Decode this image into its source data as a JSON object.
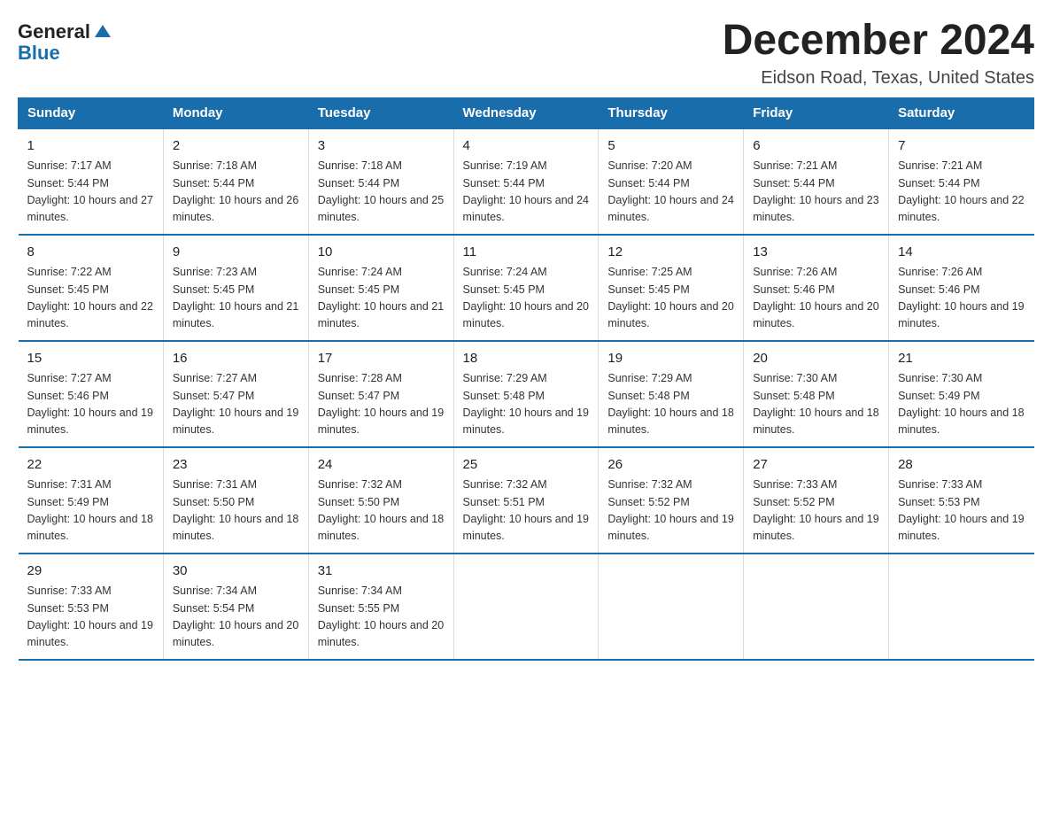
{
  "logo": {
    "text_general": "General",
    "text_blue": "Blue"
  },
  "title": "December 2024",
  "subtitle": "Eidson Road, Texas, United States",
  "headers": [
    "Sunday",
    "Monday",
    "Tuesday",
    "Wednesday",
    "Thursday",
    "Friday",
    "Saturday"
  ],
  "weeks": [
    [
      {
        "day": "1",
        "sunrise": "7:17 AM",
        "sunset": "5:44 PM",
        "daylight": "10 hours and 27 minutes."
      },
      {
        "day": "2",
        "sunrise": "7:18 AM",
        "sunset": "5:44 PM",
        "daylight": "10 hours and 26 minutes."
      },
      {
        "day": "3",
        "sunrise": "7:18 AM",
        "sunset": "5:44 PM",
        "daylight": "10 hours and 25 minutes."
      },
      {
        "day": "4",
        "sunrise": "7:19 AM",
        "sunset": "5:44 PM",
        "daylight": "10 hours and 24 minutes."
      },
      {
        "day": "5",
        "sunrise": "7:20 AM",
        "sunset": "5:44 PM",
        "daylight": "10 hours and 24 minutes."
      },
      {
        "day": "6",
        "sunrise": "7:21 AM",
        "sunset": "5:44 PM",
        "daylight": "10 hours and 23 minutes."
      },
      {
        "day": "7",
        "sunrise": "7:21 AM",
        "sunset": "5:44 PM",
        "daylight": "10 hours and 22 minutes."
      }
    ],
    [
      {
        "day": "8",
        "sunrise": "7:22 AM",
        "sunset": "5:45 PM",
        "daylight": "10 hours and 22 minutes."
      },
      {
        "day": "9",
        "sunrise": "7:23 AM",
        "sunset": "5:45 PM",
        "daylight": "10 hours and 21 minutes."
      },
      {
        "day": "10",
        "sunrise": "7:24 AM",
        "sunset": "5:45 PM",
        "daylight": "10 hours and 21 minutes."
      },
      {
        "day": "11",
        "sunrise": "7:24 AM",
        "sunset": "5:45 PM",
        "daylight": "10 hours and 20 minutes."
      },
      {
        "day": "12",
        "sunrise": "7:25 AM",
        "sunset": "5:45 PM",
        "daylight": "10 hours and 20 minutes."
      },
      {
        "day": "13",
        "sunrise": "7:26 AM",
        "sunset": "5:46 PM",
        "daylight": "10 hours and 20 minutes."
      },
      {
        "day": "14",
        "sunrise": "7:26 AM",
        "sunset": "5:46 PM",
        "daylight": "10 hours and 19 minutes."
      }
    ],
    [
      {
        "day": "15",
        "sunrise": "7:27 AM",
        "sunset": "5:46 PM",
        "daylight": "10 hours and 19 minutes."
      },
      {
        "day": "16",
        "sunrise": "7:27 AM",
        "sunset": "5:47 PM",
        "daylight": "10 hours and 19 minutes."
      },
      {
        "day": "17",
        "sunrise": "7:28 AM",
        "sunset": "5:47 PM",
        "daylight": "10 hours and 19 minutes."
      },
      {
        "day": "18",
        "sunrise": "7:29 AM",
        "sunset": "5:48 PM",
        "daylight": "10 hours and 19 minutes."
      },
      {
        "day": "19",
        "sunrise": "7:29 AM",
        "sunset": "5:48 PM",
        "daylight": "10 hours and 18 minutes."
      },
      {
        "day": "20",
        "sunrise": "7:30 AM",
        "sunset": "5:48 PM",
        "daylight": "10 hours and 18 minutes."
      },
      {
        "day": "21",
        "sunrise": "7:30 AM",
        "sunset": "5:49 PM",
        "daylight": "10 hours and 18 minutes."
      }
    ],
    [
      {
        "day": "22",
        "sunrise": "7:31 AM",
        "sunset": "5:49 PM",
        "daylight": "10 hours and 18 minutes."
      },
      {
        "day": "23",
        "sunrise": "7:31 AM",
        "sunset": "5:50 PM",
        "daylight": "10 hours and 18 minutes."
      },
      {
        "day": "24",
        "sunrise": "7:32 AM",
        "sunset": "5:50 PM",
        "daylight": "10 hours and 18 minutes."
      },
      {
        "day": "25",
        "sunrise": "7:32 AM",
        "sunset": "5:51 PM",
        "daylight": "10 hours and 19 minutes."
      },
      {
        "day": "26",
        "sunrise": "7:32 AM",
        "sunset": "5:52 PM",
        "daylight": "10 hours and 19 minutes."
      },
      {
        "day": "27",
        "sunrise": "7:33 AM",
        "sunset": "5:52 PM",
        "daylight": "10 hours and 19 minutes."
      },
      {
        "day": "28",
        "sunrise": "7:33 AM",
        "sunset": "5:53 PM",
        "daylight": "10 hours and 19 minutes."
      }
    ],
    [
      {
        "day": "29",
        "sunrise": "7:33 AM",
        "sunset": "5:53 PM",
        "daylight": "10 hours and 19 minutes."
      },
      {
        "day": "30",
        "sunrise": "7:34 AM",
        "sunset": "5:54 PM",
        "daylight": "10 hours and 20 minutes."
      },
      {
        "day": "31",
        "sunrise": "7:34 AM",
        "sunset": "5:55 PM",
        "daylight": "10 hours and 20 minutes."
      },
      {
        "day": "",
        "sunrise": "",
        "sunset": "",
        "daylight": ""
      },
      {
        "day": "",
        "sunrise": "",
        "sunset": "",
        "daylight": ""
      },
      {
        "day": "",
        "sunrise": "",
        "sunset": "",
        "daylight": ""
      },
      {
        "day": "",
        "sunrise": "",
        "sunset": "",
        "daylight": ""
      }
    ]
  ],
  "labels": {
    "sunrise_prefix": "Sunrise: ",
    "sunset_prefix": "Sunset: ",
    "daylight_prefix": "Daylight: "
  }
}
